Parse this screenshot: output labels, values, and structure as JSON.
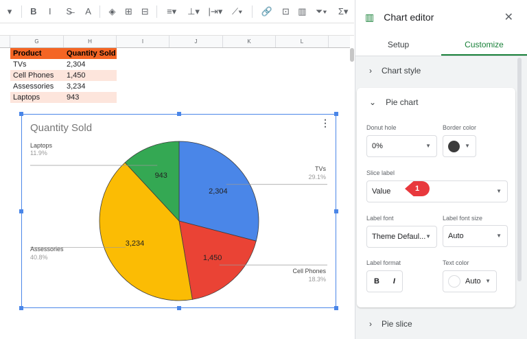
{
  "toolbar": {
    "items": [
      {
        "name": "dropdown-caret-icon",
        "g": "▾"
      },
      {
        "name": "bold-icon",
        "g": "B"
      },
      {
        "name": "italic-icon",
        "g": "I"
      },
      {
        "name": "strikethrough-icon",
        "g": "S̶"
      },
      {
        "name": "text-color-icon",
        "g": "A"
      },
      {
        "name": "fill-color-icon",
        "g": "◈"
      },
      {
        "name": "borders-icon",
        "g": "⊞"
      },
      {
        "name": "merge-cells-icon",
        "g": "⊟"
      },
      {
        "name": "horizontal-align-icon",
        "g": "≡▾"
      },
      {
        "name": "vertical-align-icon",
        "g": "⊥▾"
      },
      {
        "name": "text-wrap-icon",
        "g": "|⇥▾"
      },
      {
        "name": "text-rotate-icon",
        "g": "⟋▾"
      },
      {
        "name": "link-icon",
        "g": "🔗"
      },
      {
        "name": "comment-icon",
        "g": "⊡"
      },
      {
        "name": "chart-icon",
        "g": "▥"
      },
      {
        "name": "filter-icon",
        "g": "⏷▾"
      },
      {
        "name": "functions-icon",
        "g": "Σ▾"
      }
    ]
  },
  "columns": [
    "G",
    "H",
    "I",
    "J",
    "K",
    "L"
  ],
  "table": {
    "headers": [
      "Product",
      "Quantity Sold"
    ],
    "rows": [
      [
        "TVs",
        "2,304"
      ],
      [
        "Cell Phones",
        "1,450"
      ],
      [
        "Assessories",
        "3,234"
      ],
      [
        "Laptops",
        "943"
      ]
    ]
  },
  "chart_data": {
    "type": "pie",
    "title": "Quantity Sold",
    "categories": [
      "TVs",
      "Cell Phones",
      "Assessories",
      "Laptops"
    ],
    "values": [
      2304,
      1450,
      3234,
      943
    ],
    "value_labels": [
      "2,304",
      "1,450",
      "3,234",
      "943"
    ],
    "percent_labels": [
      "29.1%",
      "18.3%",
      "40.8%",
      "11.9%"
    ],
    "colors": [
      "#4a86e8",
      "#ea4335",
      "#fbbc04",
      "#34a853"
    ],
    "border_color": "#3c3c3c"
  },
  "editor": {
    "title": "Chart editor",
    "tabs": [
      "Setup",
      "Customize"
    ],
    "active_tab": "Customize",
    "sections": {
      "chart_style": "Chart style",
      "pie_chart": "Pie chart",
      "pie_slice": "Pie slice"
    },
    "donut_hole_label": "Donut hole",
    "donut_hole": "0%",
    "border_color_label": "Border color",
    "border_color": "#3c3c3c",
    "slice_label_label": "Slice label",
    "slice_label": "Value",
    "callout": "1",
    "label_font_label": "Label font",
    "label_font": "Theme Defaul...",
    "label_font_size_label": "Label font size",
    "label_font_size": "Auto",
    "label_format_label": "Label format",
    "bold": "B",
    "italic": "I",
    "text_color_label": "Text color",
    "text_color": "Auto"
  }
}
